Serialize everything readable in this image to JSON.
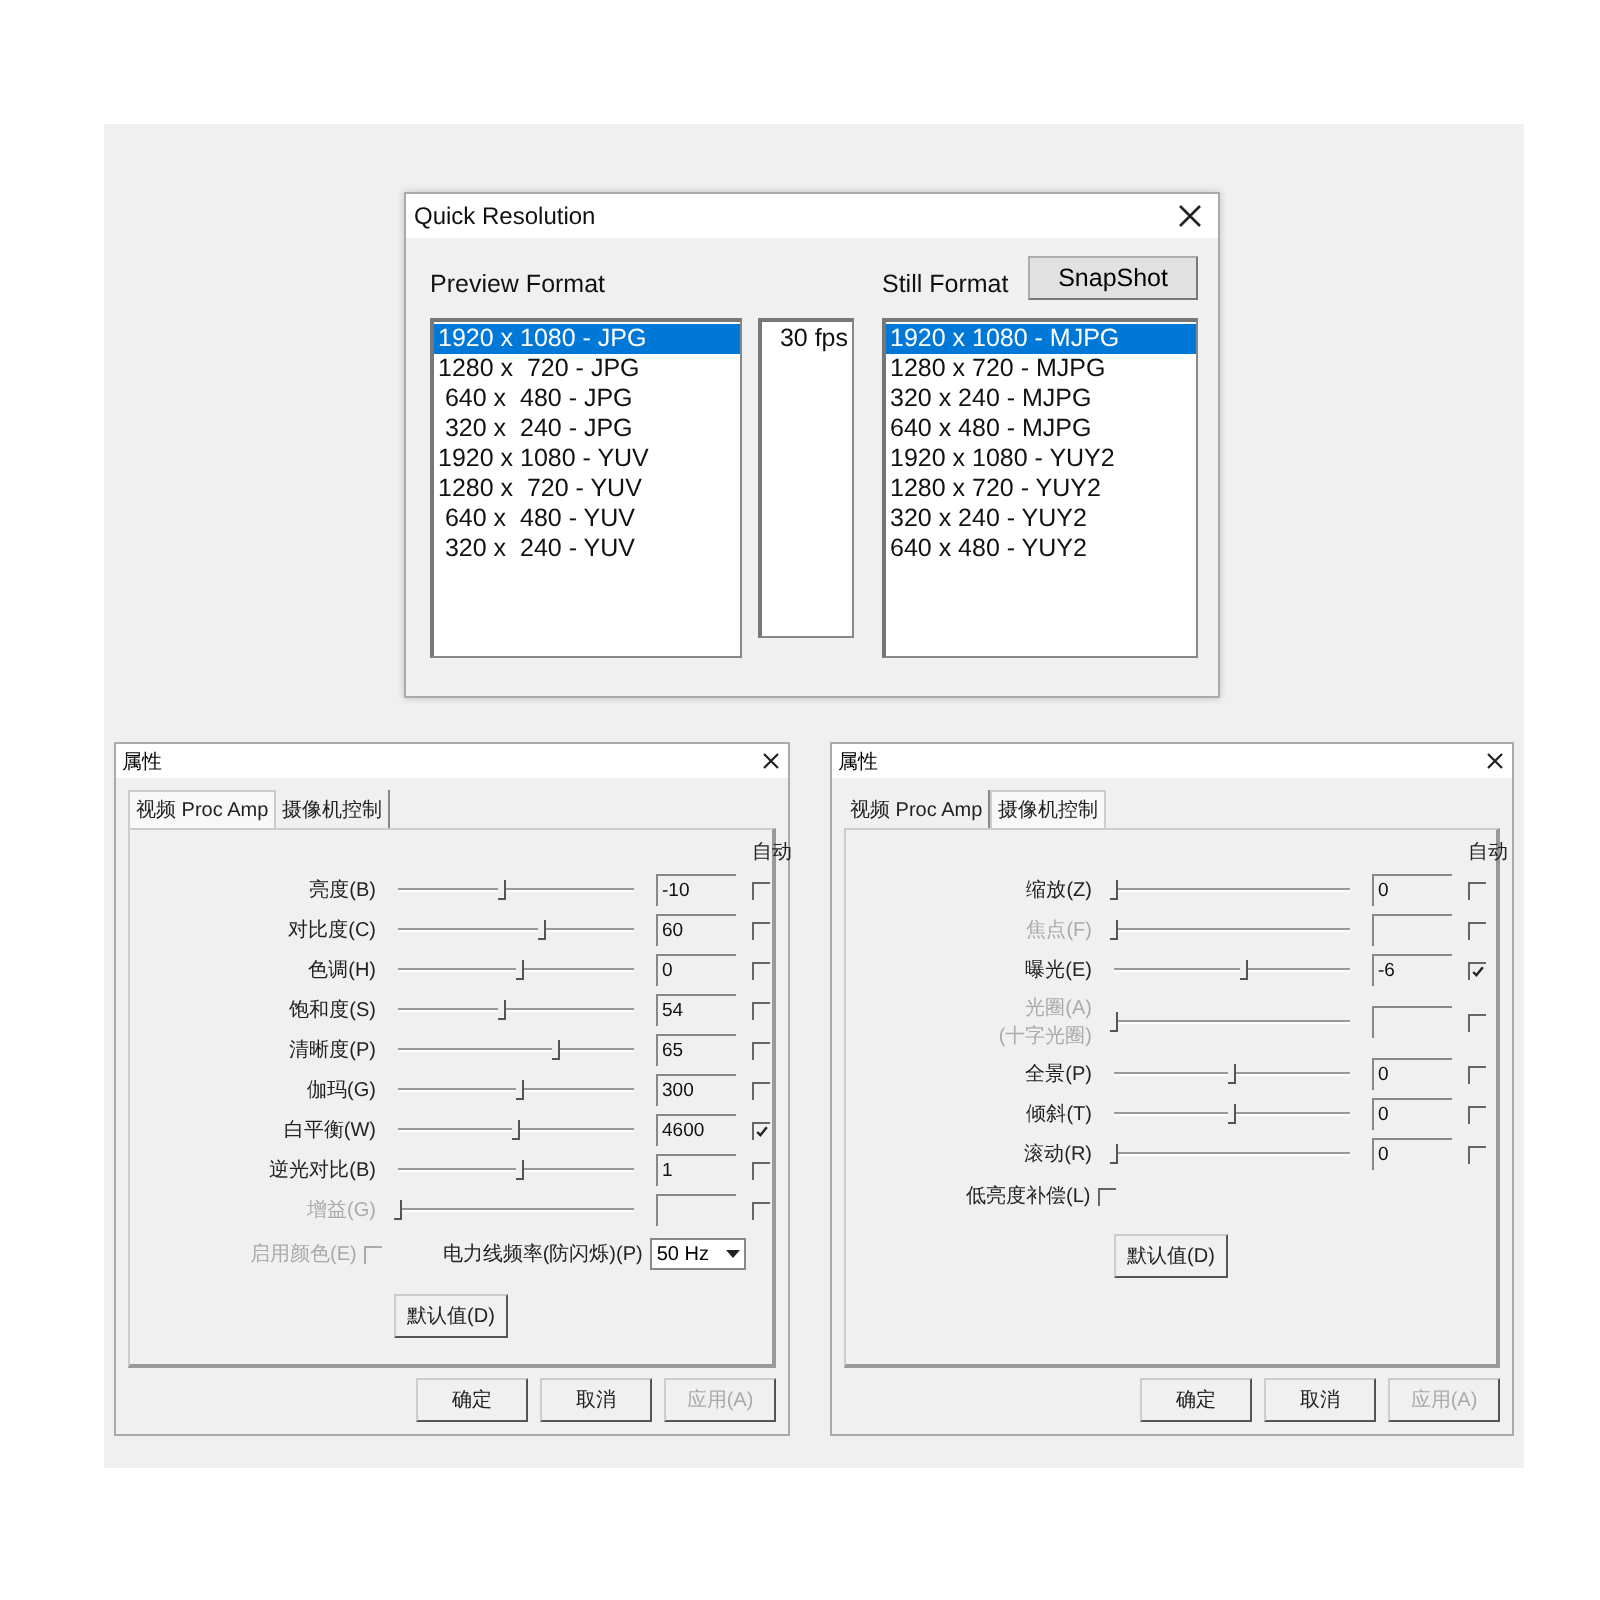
{
  "quick_resolution": {
    "title": "Quick Resolution",
    "preview_label": "Preview Format",
    "still_label": "Still Format",
    "snapshot_button": "SnapShot",
    "preview_formats": [
      {
        "label": "1920 x 1080 - JPG",
        "selected": true
      },
      {
        "label": "1280 x  720 - JPG",
        "selected": false
      },
      {
        "label": " 640 x  480 - JPG",
        "selected": false
      },
      {
        "label": " 320 x  240 - JPG",
        "selected": false
      },
      {
        "label": "1920 x 1080 - YUV",
        "selected": false
      },
      {
        "label": "1280 x  720 - YUV",
        "selected": false
      },
      {
        "label": " 640 x  480 - YUV",
        "selected": false
      },
      {
        "label": " 320 x  240 - YUV",
        "selected": false
      }
    ],
    "frame_rates": [
      {
        "label": "30 fps",
        "selected": false
      }
    ],
    "still_formats": [
      {
        "label": "1920 x 1080 - MJPG",
        "selected": true
      },
      {
        "label": "1280 x 720 - MJPG",
        "selected": false
      },
      {
        "label": "320 x 240 - MJPG",
        "selected": false
      },
      {
        "label": "640 x 480 - MJPG",
        "selected": false
      },
      {
        "label": "1920 x 1080 - YUY2",
        "selected": false
      },
      {
        "label": "1280 x 720 - YUY2",
        "selected": false
      },
      {
        "label": "320 x 240 - YUY2",
        "selected": false
      },
      {
        "label": "640 x 480 - YUY2",
        "selected": false
      }
    ]
  },
  "property_dialogs": [
    {
      "title": "属性",
      "tabs": [
        {
          "label": "视频 Proc Amp",
          "selected": true
        },
        {
          "label": "摄像机控制",
          "selected": false
        }
      ],
      "auto_header": "自动",
      "rows": [
        {
          "label": "亮度(B)",
          "disabled": false,
          "level": 0.44,
          "value": "-10",
          "auto": false
        },
        {
          "label": "对比度(C)",
          "disabled": false,
          "level": 0.61,
          "value": "60",
          "auto": false
        },
        {
          "label": "色调(H)",
          "disabled": false,
          "level": 0.52,
          "value": "0",
          "auto": false
        },
        {
          "label": "饱和度(S)",
          "disabled": false,
          "level": 0.44,
          "value": "54",
          "auto": false
        },
        {
          "label": "清晰度(P)",
          "disabled": false,
          "level": 0.67,
          "value": "65",
          "auto": false
        },
        {
          "label": "伽玛(G)",
          "disabled": false,
          "level": 0.52,
          "value": "300",
          "auto": false
        },
        {
          "label": "白平衡(W)",
          "disabled": false,
          "level": 0.5,
          "value": "4600",
          "auto": true
        },
        {
          "label": "逆光对比(B)",
          "disabled": false,
          "level": 0.52,
          "value": "1",
          "auto": false
        },
        {
          "label": "增益(G)",
          "disabled": true,
          "level": 0,
          "auto": false
        }
      ],
      "options": [
        {
          "kind": "checkbox",
          "label": "启用颜色(E)",
          "disabled": true,
          "checked": false
        },
        {
          "kind": "dropdown",
          "label": "电力线频率(防闪烁)(P)",
          "value": "50 Hz"
        }
      ],
      "default_button": "默认值(D)",
      "buttons": [
        {
          "label": "确定",
          "disabled": false
        },
        {
          "label": "取消",
          "disabled": false
        },
        {
          "label": "应用(A)",
          "disabled": true
        }
      ]
    },
    {
      "title": "属性",
      "tabs": [
        {
          "label": "视频 Proc Amp",
          "selected": false
        },
        {
          "label": "摄像机控制",
          "selected": true
        }
      ],
      "auto_header": "自动",
      "rows": [
        {
          "label": "缩放(Z)",
          "disabled": false,
          "level": 0,
          "value": "0",
          "auto": false
        },
        {
          "label": "焦点(F)",
          "disabled": true,
          "level": 0,
          "auto": false
        },
        {
          "label": "曝光(E)",
          "disabled": false,
          "level": 0.55,
          "value": "-6",
          "auto": true
        },
        {
          "label": "光圈(A)",
          "sublabel": "(十字光圈)",
          "disabled": true,
          "level": 0,
          "auto": false
        },
        {
          "label": "全景(P)",
          "disabled": false,
          "level": 0.5,
          "value": "0",
          "auto": false
        },
        {
          "label": "倾斜(T)",
          "disabled": false,
          "level": 0.5,
          "value": "0",
          "auto": false
        },
        {
          "label": "滚动(R)",
          "disabled": false,
          "level": 0,
          "value": "0",
          "auto": false
        }
      ],
      "options": [
        {
          "kind": "checkbox",
          "label": "低亮度补偿(L)",
          "disabled": false,
          "checked": false
        }
      ],
      "default_button": "默认值(D)",
      "buttons": [
        {
          "label": "确定",
          "disabled": false
        },
        {
          "label": "取消",
          "disabled": false
        },
        {
          "label": "应用(A)",
          "disabled": true
        }
      ]
    }
  ]
}
